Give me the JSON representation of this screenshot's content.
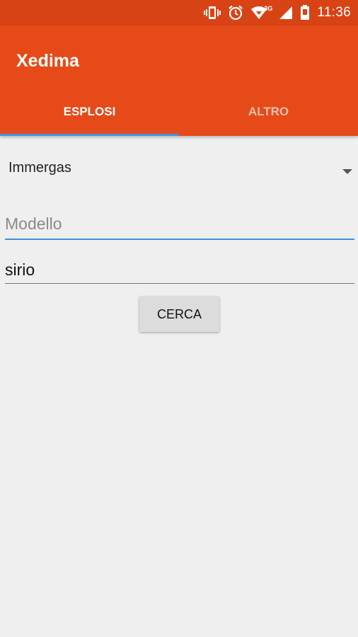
{
  "status_bar": {
    "time": "11:36",
    "network_label": "3G",
    "icons": [
      "vibrate-icon",
      "alarm-icon",
      "wifi-icon",
      "signal-icon",
      "battery-icon"
    ]
  },
  "app_bar": {
    "title": "Xedima",
    "color": "#e64a19"
  },
  "tabs": [
    {
      "label": "ESPLOSI",
      "active": true
    },
    {
      "label": "ALTRO",
      "active": false
    }
  ],
  "form": {
    "brand_select": {
      "selected": "Immergas"
    },
    "model_input": {
      "placeholder": "Modello",
      "value": ""
    },
    "series_input": {
      "value": "sirio"
    },
    "search_button_label": "CERCA"
  },
  "colors": {
    "status_bar": "#d84315",
    "accent": "#4a90e2",
    "background": "#efefef"
  }
}
